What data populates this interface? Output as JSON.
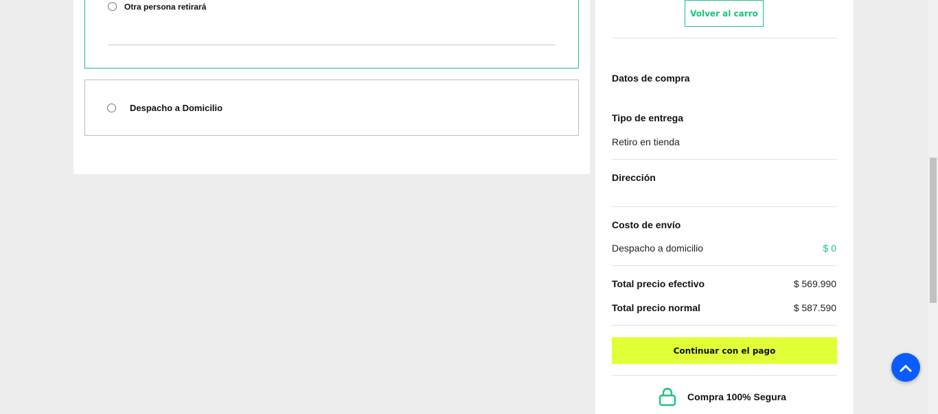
{
  "delivery_options": {
    "sub_option_label": "Otra persona retirará",
    "home_delivery_label": "Despacho a Domicilio"
  },
  "summary": {
    "back_button": "Volver al carro",
    "purchase_data_title": "Datos de compra",
    "delivery_type_title": "Tipo de entrega",
    "delivery_type_value": "Retiro en tienda",
    "address_title": "Dirección",
    "shipping_cost_title": "Costo de envío",
    "shipping_method": "Despacho a domicilio",
    "shipping_cost_value": "$ 0",
    "total_cash_label": "Total precio efectivo",
    "total_cash_value": "$ 569.990",
    "total_normal_label": "Total precio normal",
    "total_normal_value": "$ 587.590",
    "pay_button": "Continuar con el pago",
    "secure_label": "Compra 100% Segura"
  },
  "icons": {
    "lock": "lock-icon",
    "scroll_top": "chevron-up-icon"
  },
  "colors": {
    "accent_green": "#19c37d",
    "pay_button_bg": "#e2ff38",
    "scroll_top_bg": "#0b5cff"
  }
}
